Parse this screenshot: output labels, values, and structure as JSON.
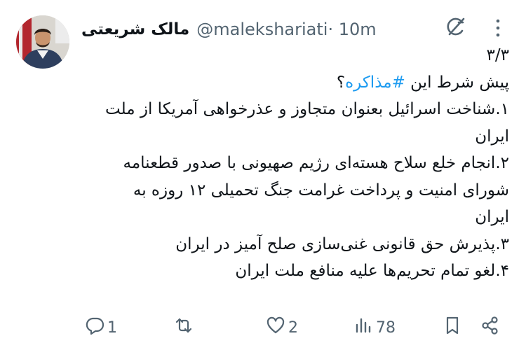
{
  "author": {
    "name": "مالک شریعتی",
    "handle": "@malekshariati",
    "timestamp": "· 10m"
  },
  "tweet": {
    "thread_index": "۳/۳",
    "intro_pre": "پیش شرط این",
    "hashtag": "#مذاکره",
    "intro_post": "؟",
    "lines": [
      "۱.شناخت اسرائیل بعنوان متجاوز و عذرخواهی آمریکا از ملت",
      "ایران",
      "۲.انجام خلع سلاح هسته‌ای رژیم صهیونی با صدور قطعنامه",
      "شورای امنیت و پرداخت غرامت جنگ تحمیلی ۱۲ روزه به",
      "ایران",
      "۳.پذیرش حق قانونی غنی‌سازی صلح آمیز در ایران",
      "۴.لغو تمام تحریم‌ها علیه منافع ملت ایران"
    ]
  },
  "actions": {
    "reply_count": "1",
    "repost_count": "",
    "like_count": "2",
    "views_count": "78"
  },
  "icons": {
    "grok": "grok-icon",
    "more": "more-icon",
    "reply": "reply-icon",
    "repost": "repost-icon",
    "like": "heart-icon",
    "views": "views-icon",
    "bookmark": "bookmark-icon",
    "share": "share-icon"
  },
  "colors": {
    "text": "#0f1419",
    "secondary": "#536471",
    "link": "#1d9bf0"
  }
}
